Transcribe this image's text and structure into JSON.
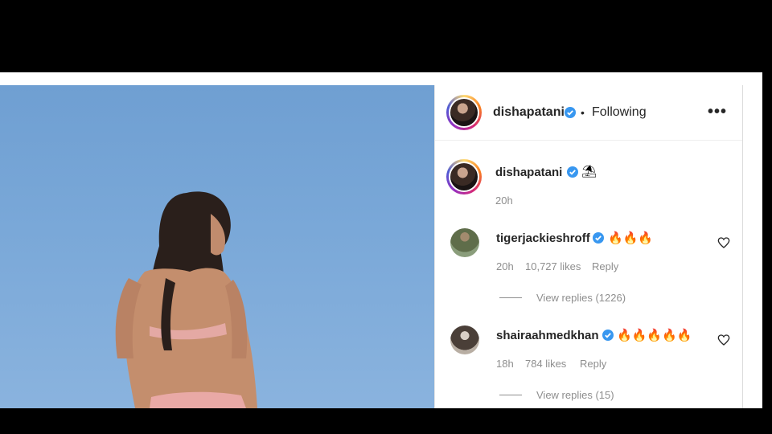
{
  "post": {
    "author": "dishapatani",
    "follow_status": "Following",
    "dot_separator": "•",
    "more_icon": "more-horizontal-icon"
  },
  "caption": {
    "author": "dishapatani",
    "text_emoji": "⛱",
    "time": "20h"
  },
  "comments": [
    {
      "user": "tigerjackieshroff",
      "text": "🔥🔥🔥",
      "time": "20h",
      "likes": "10,727 likes",
      "reply_label": "Reply",
      "view_replies": "View replies (1226)"
    },
    {
      "user": "shairaahmedkhan",
      "text": "🔥🔥🔥🔥🔥",
      "time": "18h",
      "likes": "784 likes",
      "reply_label": "Reply",
      "view_replies": "View replies (15)"
    }
  ],
  "colors": {
    "verified": "#3897f0",
    "text": "#262626",
    "muted": "#8e8e8e"
  }
}
